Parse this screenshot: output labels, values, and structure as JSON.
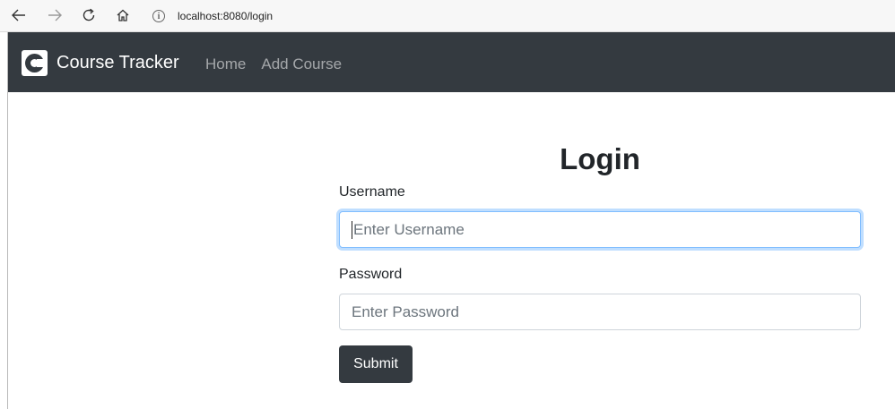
{
  "browser": {
    "url": "localhost:8080/login",
    "back_icon": "arrow-left-icon",
    "forward_icon": "arrow-right-icon",
    "reload_icon": "reload-icon",
    "home_icon": "home-icon",
    "info_icon": "info-icon"
  },
  "navbar": {
    "brand": "Course Tracker",
    "links": [
      "Home",
      "Add Course"
    ],
    "background": "#343a40"
  },
  "login": {
    "title": "Login",
    "username_label": "Username",
    "username_placeholder": "Enter Username",
    "password_label": "Password",
    "password_placeholder": "Enter Password",
    "submit_label": "Submit"
  }
}
